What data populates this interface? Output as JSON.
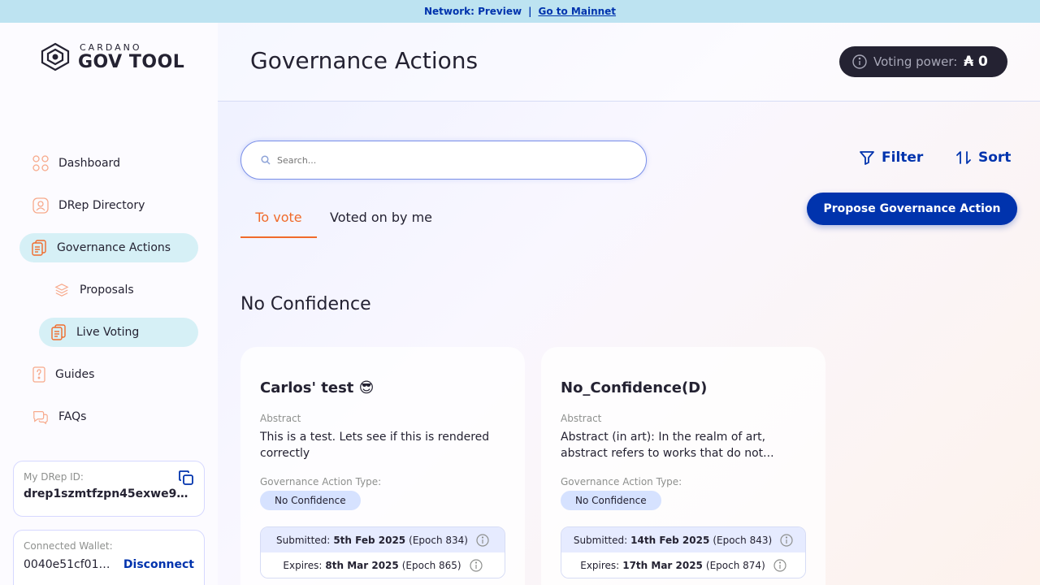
{
  "banner": {
    "network": "Network: Preview",
    "separator": "|",
    "link": "Go to Mainnet"
  },
  "logo": {
    "small": "CARDANO",
    "big": "GOV TOOL"
  },
  "sidebar": {
    "items": [
      {
        "label": "Dashboard",
        "icon": "dashboard-icon"
      },
      {
        "label": "DRep Directory",
        "icon": "drep-directory-icon"
      },
      {
        "label": "Governance Actions",
        "icon": "governance-actions-icon"
      },
      {
        "label": "Proposals",
        "icon": "proposals-icon"
      },
      {
        "label": "Live Voting",
        "icon": "live-voting-icon"
      },
      {
        "label": "Guides",
        "icon": "guides-icon"
      },
      {
        "label": "FAQs",
        "icon": "faqs-icon"
      }
    ],
    "drep": {
      "label": "My DRep ID:",
      "id": "drep1szmtfzpn45exwe9uxz..."
    },
    "wallet": {
      "label": "Connected Wallet:",
      "address": "0040e51cf01d5...",
      "disconnect": "Disconnect"
    }
  },
  "header": {
    "title": "Governance Actions",
    "voting_power_label": "Voting power:",
    "voting_power_value": "₳ 0"
  },
  "search": {
    "placeholder": "Search..."
  },
  "toolbar": {
    "filter": "Filter",
    "sort": "Sort",
    "propose": "Propose Governance Action"
  },
  "tabs": [
    {
      "label": "To vote",
      "active": true
    },
    {
      "label": "Voted on by me",
      "active": false
    }
  ],
  "section": {
    "title": "No Confidence"
  },
  "cards": [
    {
      "title": "Carlos' test 😎",
      "abstract_label": "Abstract",
      "abstract": "This is a test. Lets see if this is rendered correctly",
      "type_label": "Governance Action Type:",
      "type": "No Confidence",
      "submitted_label": "Submitted:",
      "submitted_date": "5th Feb 2025",
      "submitted_epoch": "(Epoch 834)",
      "expires_label": "Expires:",
      "expires_date": "8th Mar 2025",
      "expires_epoch": "(Epoch 865)"
    },
    {
      "title": "No_Confidence(D)",
      "abstract_label": "Abstract",
      "abstract": "Abstract (in art): In the realm of art, abstract refers to works that do not...",
      "type_label": "Governance Action Type:",
      "type": "No Confidence",
      "submitted_label": "Submitted:",
      "submitted_date": "14th Feb 2025",
      "submitted_epoch": "(Epoch 843)",
      "expires_label": "Expires:",
      "expires_date": "17th Mar 2025",
      "expires_epoch": "(Epoch 874)"
    }
  ],
  "colors": {
    "primary": "#0033ad",
    "accent": "#f06b2b",
    "banner": "#bde3f1",
    "active_nav": "#d6f0f6",
    "dark": "#242232"
  }
}
